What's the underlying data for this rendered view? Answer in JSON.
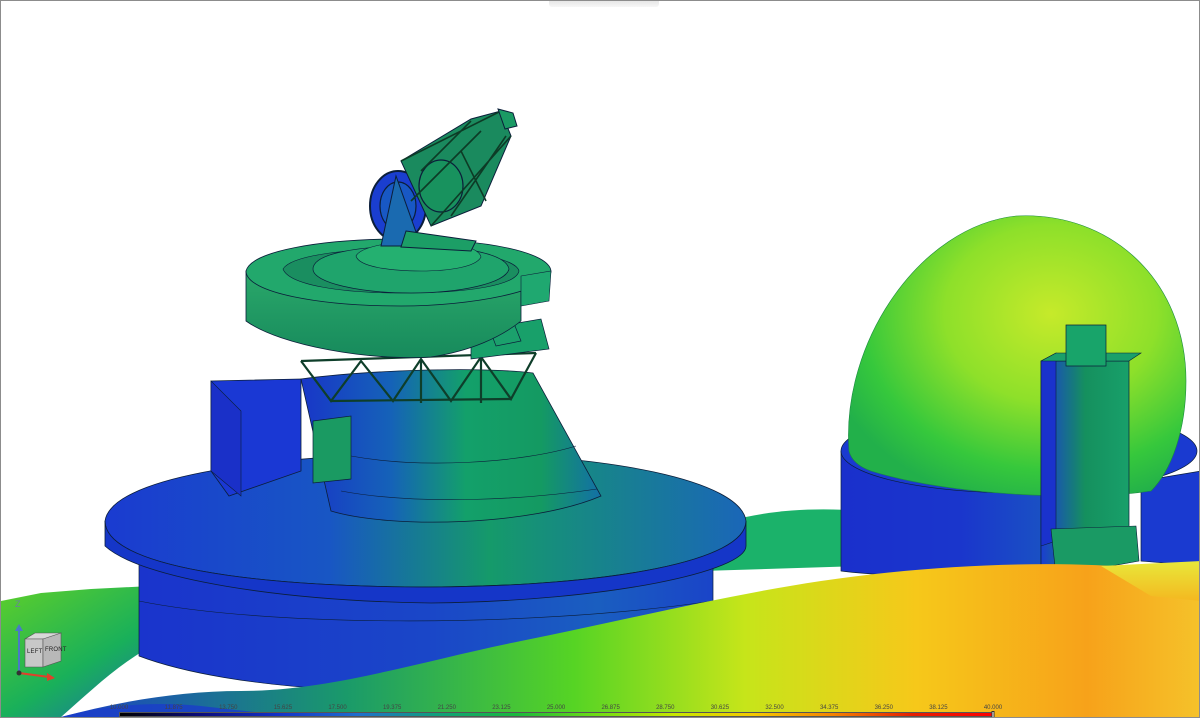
{
  "colorbar": {
    "ticks": [
      "10.000",
      "11.875",
      "13.750",
      "15.625",
      "17.500",
      "19.375",
      "21.250",
      "23.125",
      "25.000",
      "26.875",
      "28.750",
      "30.625",
      "32.500",
      "34.375",
      "36.250",
      "38.125",
      "40.000"
    ],
    "marker_value": 40.0,
    "min": 10.0,
    "max": 40.0,
    "gradient_colors": [
      "#000000",
      "#0a0a7a",
      "#1432c8",
      "#1e6ecd",
      "#0fa07a",
      "#19b93c",
      "#6edc14",
      "#c8e600",
      "#f5c800",
      "#f58200",
      "#e61e00",
      "#ff0000"
    ]
  },
  "nav_cube": {
    "axis_z": "Z",
    "face_left": "LEFT",
    "face_front": "FRONT",
    "icon": "view-cube-icon"
  },
  "colors": {
    "low": "#1428c8",
    "mid": "#13a25a",
    "high": "#f59a10",
    "outline": "#0b1e3a"
  }
}
